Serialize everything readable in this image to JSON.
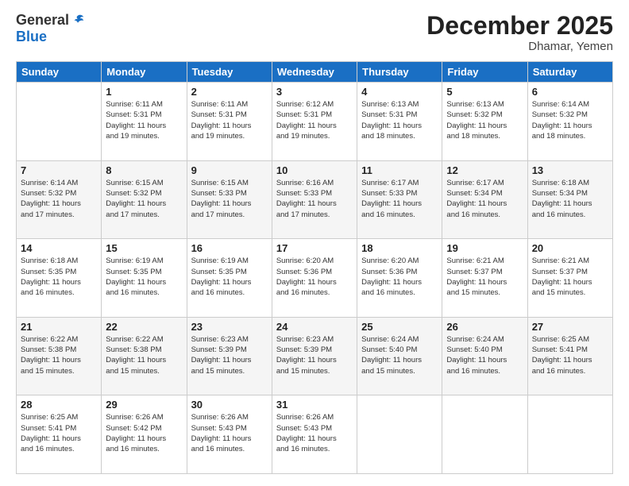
{
  "logo": {
    "general": "General",
    "blue": "Blue"
  },
  "title": "December 2025",
  "location": "Dhamar, Yemen",
  "days_of_week": [
    "Sunday",
    "Monday",
    "Tuesday",
    "Wednesday",
    "Thursday",
    "Friday",
    "Saturday"
  ],
  "weeks": [
    [
      {
        "day": "",
        "info": ""
      },
      {
        "day": "1",
        "info": "Sunrise: 6:11 AM\nSunset: 5:31 PM\nDaylight: 11 hours\nand 19 minutes."
      },
      {
        "day": "2",
        "info": "Sunrise: 6:11 AM\nSunset: 5:31 PM\nDaylight: 11 hours\nand 19 minutes."
      },
      {
        "day": "3",
        "info": "Sunrise: 6:12 AM\nSunset: 5:31 PM\nDaylight: 11 hours\nand 19 minutes."
      },
      {
        "day": "4",
        "info": "Sunrise: 6:13 AM\nSunset: 5:31 PM\nDaylight: 11 hours\nand 18 minutes."
      },
      {
        "day": "5",
        "info": "Sunrise: 6:13 AM\nSunset: 5:32 PM\nDaylight: 11 hours\nand 18 minutes."
      },
      {
        "day": "6",
        "info": "Sunrise: 6:14 AM\nSunset: 5:32 PM\nDaylight: 11 hours\nand 18 minutes."
      }
    ],
    [
      {
        "day": "7",
        "info": "Sunrise: 6:14 AM\nSunset: 5:32 PM\nDaylight: 11 hours\nand 17 minutes."
      },
      {
        "day": "8",
        "info": "Sunrise: 6:15 AM\nSunset: 5:32 PM\nDaylight: 11 hours\nand 17 minutes."
      },
      {
        "day": "9",
        "info": "Sunrise: 6:15 AM\nSunset: 5:33 PM\nDaylight: 11 hours\nand 17 minutes."
      },
      {
        "day": "10",
        "info": "Sunrise: 6:16 AM\nSunset: 5:33 PM\nDaylight: 11 hours\nand 17 minutes."
      },
      {
        "day": "11",
        "info": "Sunrise: 6:17 AM\nSunset: 5:33 PM\nDaylight: 11 hours\nand 16 minutes."
      },
      {
        "day": "12",
        "info": "Sunrise: 6:17 AM\nSunset: 5:34 PM\nDaylight: 11 hours\nand 16 minutes."
      },
      {
        "day": "13",
        "info": "Sunrise: 6:18 AM\nSunset: 5:34 PM\nDaylight: 11 hours\nand 16 minutes."
      }
    ],
    [
      {
        "day": "14",
        "info": "Sunrise: 6:18 AM\nSunset: 5:35 PM\nDaylight: 11 hours\nand 16 minutes."
      },
      {
        "day": "15",
        "info": "Sunrise: 6:19 AM\nSunset: 5:35 PM\nDaylight: 11 hours\nand 16 minutes."
      },
      {
        "day": "16",
        "info": "Sunrise: 6:19 AM\nSunset: 5:35 PM\nDaylight: 11 hours\nand 16 minutes."
      },
      {
        "day": "17",
        "info": "Sunrise: 6:20 AM\nSunset: 5:36 PM\nDaylight: 11 hours\nand 16 minutes."
      },
      {
        "day": "18",
        "info": "Sunrise: 6:20 AM\nSunset: 5:36 PM\nDaylight: 11 hours\nand 16 minutes."
      },
      {
        "day": "19",
        "info": "Sunrise: 6:21 AM\nSunset: 5:37 PM\nDaylight: 11 hours\nand 15 minutes."
      },
      {
        "day": "20",
        "info": "Sunrise: 6:21 AM\nSunset: 5:37 PM\nDaylight: 11 hours\nand 15 minutes."
      }
    ],
    [
      {
        "day": "21",
        "info": "Sunrise: 6:22 AM\nSunset: 5:38 PM\nDaylight: 11 hours\nand 15 minutes."
      },
      {
        "day": "22",
        "info": "Sunrise: 6:22 AM\nSunset: 5:38 PM\nDaylight: 11 hours\nand 15 minutes."
      },
      {
        "day": "23",
        "info": "Sunrise: 6:23 AM\nSunset: 5:39 PM\nDaylight: 11 hours\nand 15 minutes."
      },
      {
        "day": "24",
        "info": "Sunrise: 6:23 AM\nSunset: 5:39 PM\nDaylight: 11 hours\nand 15 minutes."
      },
      {
        "day": "25",
        "info": "Sunrise: 6:24 AM\nSunset: 5:40 PM\nDaylight: 11 hours\nand 15 minutes."
      },
      {
        "day": "26",
        "info": "Sunrise: 6:24 AM\nSunset: 5:40 PM\nDaylight: 11 hours\nand 16 minutes."
      },
      {
        "day": "27",
        "info": "Sunrise: 6:25 AM\nSunset: 5:41 PM\nDaylight: 11 hours\nand 16 minutes."
      }
    ],
    [
      {
        "day": "28",
        "info": "Sunrise: 6:25 AM\nSunset: 5:41 PM\nDaylight: 11 hours\nand 16 minutes."
      },
      {
        "day": "29",
        "info": "Sunrise: 6:26 AM\nSunset: 5:42 PM\nDaylight: 11 hours\nand 16 minutes."
      },
      {
        "day": "30",
        "info": "Sunrise: 6:26 AM\nSunset: 5:43 PM\nDaylight: 11 hours\nand 16 minutes."
      },
      {
        "day": "31",
        "info": "Sunrise: 6:26 AM\nSunset: 5:43 PM\nDaylight: 11 hours\nand 16 minutes."
      },
      {
        "day": "",
        "info": ""
      },
      {
        "day": "",
        "info": ""
      },
      {
        "day": "",
        "info": ""
      }
    ]
  ]
}
